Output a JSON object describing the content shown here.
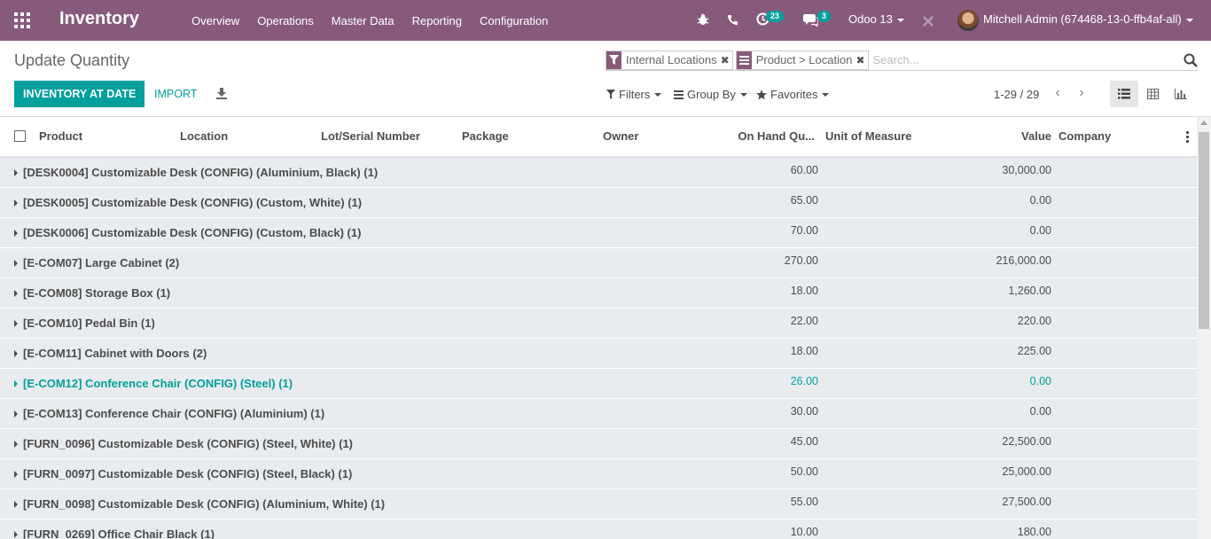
{
  "navbar": {
    "app_title": "Inventory",
    "menu": [
      "Overview",
      "Operations",
      "Master Data",
      "Reporting",
      "Configuration"
    ],
    "activity_count": "23",
    "messages_count": "3",
    "database": "Odoo 13",
    "user": "Mitchell Admin (674468-13-0-ffb4af-all)",
    "brand_color": "#875a7b"
  },
  "control_panel": {
    "breadcrumb": "Update Quantity",
    "primary_button": "INVENTORY AT DATE",
    "import_button": "IMPORT",
    "facets": [
      {
        "icon": "filter-icon",
        "label": "Internal Locations"
      },
      {
        "icon": "group-icon",
        "label": "Product > Location"
      }
    ],
    "search_placeholder": "Search...",
    "filters_label": "Filters",
    "groupby_label": "Group By",
    "favorites_label": "Favorites",
    "pager": "1-29 / 29"
  },
  "table": {
    "columns": [
      "Product",
      "Location",
      "Lot/Serial Number",
      "Package",
      "Owner",
      "On Hand Qu...",
      "Unit of Measure",
      "Value",
      "Company"
    ],
    "groups": [
      {
        "name": "[DESK0004] Customizable Desk (CONFIG) (Aluminium, Black) (1)",
        "qty": "60.00",
        "value": "30,000.00"
      },
      {
        "name": "[DESK0005] Customizable Desk (CONFIG) (Custom, White) (1)",
        "qty": "65.00",
        "value": "0.00"
      },
      {
        "name": "[DESK0006] Customizable Desk (CONFIG) (Custom, Black) (1)",
        "qty": "70.00",
        "value": "0.00"
      },
      {
        "name": "[E-COM07] Large Cabinet (2)",
        "qty": "270.00",
        "value": "216,000.00"
      },
      {
        "name": "[E-COM08] Storage Box (1)",
        "qty": "18.00",
        "value": "1,260.00"
      },
      {
        "name": "[E-COM10] Pedal Bin (1)",
        "qty": "22.00",
        "value": "220.00"
      },
      {
        "name": "[E-COM11] Cabinet with Doors (2)",
        "qty": "18.00",
        "value": "225.00"
      },
      {
        "name": "[E-COM12] Conference Chair (CONFIG) (Steel) (1)",
        "qty": "26.00",
        "value": "0.00"
      },
      {
        "name": "[E-COM13] Conference Chair (CONFIG) (Aluminium) (1)",
        "qty": "30.00",
        "value": "0.00"
      },
      {
        "name": "[FURN_0096] Customizable Desk (CONFIG) (Steel, White) (1)",
        "qty": "45.00",
        "value": "22,500.00"
      },
      {
        "name": "[FURN_0097] Customizable Desk (CONFIG) (Steel, Black) (1)",
        "qty": "50.00",
        "value": "25,000.00"
      },
      {
        "name": "[FURN_0098] Customizable Desk (CONFIG) (Aluminium, White) (1)",
        "qty": "55.00",
        "value": "27,500.00"
      },
      {
        "name": "[FURN_0269] Office Chair Black (1)",
        "qty": "10.00",
        "value": "180.00"
      }
    ],
    "highlight_color": "#00a09d"
  }
}
